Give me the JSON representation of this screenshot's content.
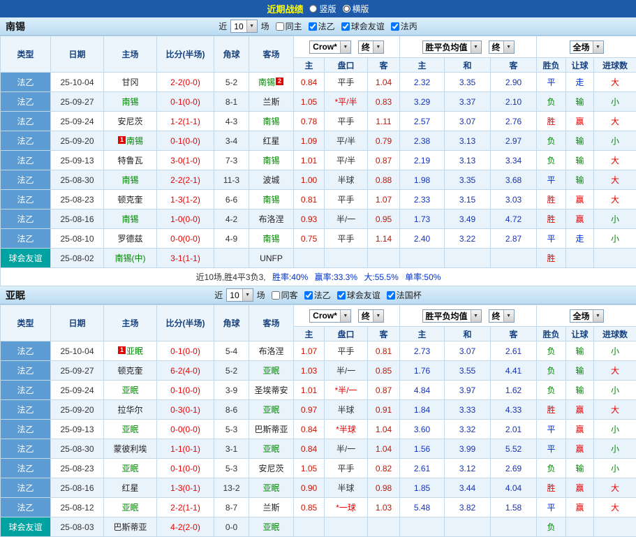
{
  "top_bar": {
    "title": "近期战绩",
    "layout_options": [
      {
        "label": "竖版",
        "selected": false
      },
      {
        "label": "横版",
        "selected": true
      }
    ]
  },
  "controls": {
    "near": "近",
    "count": "10",
    "games": "场"
  },
  "table_header": {
    "type": "类型",
    "date": "日期",
    "home": "主场",
    "score": "比分(半场)",
    "corners": "角球",
    "away": "客场",
    "odds_home": "主",
    "handicap": "盘口",
    "odds_away": "客",
    "avg_home": "主",
    "avg_draw": "和",
    "avg_away": "客",
    "result": "胜负",
    "handicap_result": "让球",
    "goals": "进球数",
    "odds_source_select": "Crow*",
    "odds_time_select": "终",
    "avg_select": "胜平负均值",
    "avg_time_select": "终",
    "scope_select": "全场"
  },
  "sections": [
    {
      "team": "南锡",
      "filters": [
        {
          "label": "同主",
          "checked": false
        },
        {
          "label": "法乙",
          "checked": true
        },
        {
          "label": "球会友谊",
          "checked": true
        },
        {
          "label": "法丙",
          "checked": true
        }
      ],
      "rows": [
        {
          "league": "法乙",
          "date": "25-10-04",
          "home": "甘冈",
          "score": "2-2(0-0)",
          "corners": "5-2",
          "away": "南锡",
          "away_green": true,
          "away_badge_post": "2",
          "odds": [
            "0.84",
            "平手",
            "1.04"
          ],
          "avg": [
            "2.32",
            "3.35",
            "2.90"
          ],
          "outcome": [
            "平",
            "走",
            "大"
          ]
        },
        {
          "league": "法乙",
          "date": "25-09-27",
          "home": "南锡",
          "home_green": true,
          "score": "0-1(0-0)",
          "corners": "8-1",
          "away": "兰斯",
          "odds": [
            "1.05",
            "*平/半",
            "0.83"
          ],
          "avg": [
            "3.29",
            "3.37",
            "2.10"
          ],
          "outcome": [
            "负",
            "输",
            "小"
          ]
        },
        {
          "league": "法乙",
          "date": "25-09-24",
          "home": "安尼茨",
          "score": "1-2(1-1)",
          "corners": "4-3",
          "away": "南锡",
          "away_green": true,
          "odds": [
            "0.78",
            "平手",
            "1.11"
          ],
          "avg": [
            "2.57",
            "3.07",
            "2.76"
          ],
          "outcome": [
            "胜",
            "赢",
            "大"
          ]
        },
        {
          "league": "法乙",
          "date": "25-09-20",
          "home": "南锡",
          "home_green": true,
          "home_badge_pre": "1",
          "score": "0-1(0-0)",
          "corners": "3-4",
          "away": "红星",
          "odds": [
            "1.09",
            "平/半",
            "0.79"
          ],
          "avg": [
            "2.38",
            "3.13",
            "2.97"
          ],
          "outcome": [
            "负",
            "输",
            "小"
          ]
        },
        {
          "league": "法乙",
          "date": "25-09-13",
          "home": "特鲁瓦",
          "score": "3-0(1-0)",
          "corners": "7-3",
          "away": "南锡",
          "away_green": true,
          "odds": [
            "1.01",
            "平/半",
            "0.87"
          ],
          "avg": [
            "2.19",
            "3.13",
            "3.34"
          ],
          "outcome": [
            "负",
            "输",
            "大"
          ]
        },
        {
          "league": "法乙",
          "date": "25-08-30",
          "home": "南锡",
          "home_green": true,
          "score": "2-2(2-1)",
          "corners": "11-3",
          "away": "波城",
          "odds": [
            "1.00",
            "半球",
            "0.88"
          ],
          "avg": [
            "1.98",
            "3.35",
            "3.68"
          ],
          "outcome": [
            "平",
            "输",
            "大"
          ]
        },
        {
          "league": "法乙",
          "date": "25-08-23",
          "home": "顿克奎",
          "score": "1-3(1-2)",
          "corners": "6-6",
          "away": "南锡",
          "away_green": true,
          "odds": [
            "0.81",
            "平手",
            "1.07"
          ],
          "avg": [
            "2.33",
            "3.15",
            "3.03"
          ],
          "outcome": [
            "胜",
            "赢",
            "大"
          ]
        },
        {
          "league": "法乙",
          "date": "25-08-16",
          "home": "南锡",
          "home_green": true,
          "score": "1-0(0-0)",
          "corners": "4-2",
          "away": "布洛涅",
          "odds": [
            "0.93",
            "半/一",
            "0.95"
          ],
          "avg": [
            "1.73",
            "3.49",
            "4.72"
          ],
          "outcome": [
            "胜",
            "赢",
            "小"
          ]
        },
        {
          "league": "法乙",
          "date": "25-08-10",
          "home": "罗德兹",
          "score": "0-0(0-0)",
          "corners": "4-9",
          "away": "南锡",
          "away_green": true,
          "odds": [
            "0.75",
            "平手",
            "1.14"
          ],
          "avg": [
            "2.40",
            "3.22",
            "2.87"
          ],
          "outcome": [
            "平",
            "走",
            "小"
          ]
        },
        {
          "league": "球会友谊",
          "friendly": true,
          "date": "25-08-02",
          "home": "南锡(中)",
          "home_green": true,
          "score": "3-1(1-1)",
          "corners": "",
          "away": "UNFP",
          "odds": [
            "",
            "",
            ""
          ],
          "avg": [
            "",
            "",
            ""
          ],
          "outcome": [
            "胜",
            "",
            ""
          ]
        }
      ],
      "summary": {
        "prefix": "近10场,胜4平3负3,",
        "stats": [
          "胜率:40%",
          "赢率:33.3%",
          "大:55.5%",
          "单率:50%"
        ]
      }
    },
    {
      "team": "亚眠",
      "filters": [
        {
          "label": "同客",
          "checked": false
        },
        {
          "label": "法乙",
          "checked": true
        },
        {
          "label": "球会友谊",
          "checked": true
        },
        {
          "label": "法国杯",
          "checked": true
        }
      ],
      "rows": [
        {
          "league": "法乙",
          "date": "25-10-04",
          "home": "亚眠",
          "home_green": true,
          "home_badge_pre": "1",
          "score": "0-1(0-0)",
          "corners": "5-4",
          "away": "布洛涅",
          "odds": [
            "1.07",
            "平手",
            "0.81"
          ],
          "avg": [
            "2.73",
            "3.07",
            "2.61"
          ],
          "outcome": [
            "负",
            "输",
            "小"
          ]
        },
        {
          "league": "法乙",
          "date": "25-09-27",
          "home": "顿克奎",
          "score": "6-2(4-0)",
          "corners": "5-2",
          "away": "亚眠",
          "away_green": true,
          "odds": [
            "1.03",
            "半/一",
            "0.85"
          ],
          "avg": [
            "1.76",
            "3.55",
            "4.41"
          ],
          "outcome": [
            "负",
            "输",
            "大"
          ]
        },
        {
          "league": "法乙",
          "date": "25-09-24",
          "home": "亚眠",
          "home_green": true,
          "score": "0-1(0-0)",
          "corners": "3-9",
          "away": "圣埃蒂安",
          "odds": [
            "1.01",
            "*半/一",
            "0.87"
          ],
          "avg": [
            "4.84",
            "3.97",
            "1.62"
          ],
          "outcome": [
            "负",
            "输",
            "小"
          ]
        },
        {
          "league": "法乙",
          "date": "25-09-20",
          "home": "拉华尔",
          "score": "0-3(0-1)",
          "corners": "8-6",
          "away": "亚眠",
          "away_green": true,
          "odds": [
            "0.97",
            "半球",
            "0.91"
          ],
          "avg": [
            "1.84",
            "3.33",
            "4.33"
          ],
          "outcome": [
            "胜",
            "赢",
            "大"
          ]
        },
        {
          "league": "法乙",
          "date": "25-09-13",
          "home": "亚眠",
          "home_green": true,
          "score": "0-0(0-0)",
          "corners": "5-3",
          "away": "巴斯蒂亚",
          "odds": [
            "0.84",
            "*半球",
            "1.04"
          ],
          "avg": [
            "3.60",
            "3.32",
            "2.01"
          ],
          "outcome": [
            "平",
            "赢",
            "小"
          ]
        },
        {
          "league": "法乙",
          "date": "25-08-30",
          "home": "蒙彼利埃",
          "score": "1-1(0-1)",
          "corners": "3-1",
          "away": "亚眠",
          "away_green": true,
          "odds": [
            "0.84",
            "半/一",
            "1.04"
          ],
          "avg": [
            "1.56",
            "3.99",
            "5.52"
          ],
          "outcome": [
            "平",
            "赢",
            "小"
          ]
        },
        {
          "league": "法乙",
          "date": "25-08-23",
          "home": "亚眠",
          "home_green": true,
          "score": "0-1(0-0)",
          "corners": "5-3",
          "away": "安尼茨",
          "odds": [
            "1.05",
            "平手",
            "0.82"
          ],
          "avg": [
            "2.61",
            "3.12",
            "2.69"
          ],
          "outcome": [
            "负",
            "输",
            "小"
          ]
        },
        {
          "league": "法乙",
          "date": "25-08-16",
          "home": "红星",
          "score": "1-3(0-1)",
          "corners": "13-2",
          "away": "亚眠",
          "away_green": true,
          "odds": [
            "0.90",
            "半球",
            "0.98"
          ],
          "avg": [
            "1.85",
            "3.44",
            "4.04"
          ],
          "outcome": [
            "胜",
            "赢",
            "大"
          ]
        },
        {
          "league": "法乙",
          "date": "25-08-12",
          "home": "亚眠",
          "home_green": true,
          "score": "2-2(1-1)",
          "corners": "8-7",
          "away": "兰斯",
          "odds": [
            "0.85",
            "*一球",
            "1.03"
          ],
          "avg": [
            "5.48",
            "3.82",
            "1.58"
          ],
          "outcome": [
            "平",
            "赢",
            "大"
          ]
        },
        {
          "league": "球会友谊",
          "friendly": true,
          "date": "25-08-03",
          "home": "巴斯蒂亚",
          "score": "4-2(2-0)",
          "corners": "0-0",
          "away": "亚眠",
          "away_green": true,
          "odds": [
            "",
            "",
            ""
          ],
          "avg": [
            "",
            "",
            ""
          ],
          "outcome": [
            "负",
            "",
            ""
          ]
        }
      ]
    }
  ]
}
